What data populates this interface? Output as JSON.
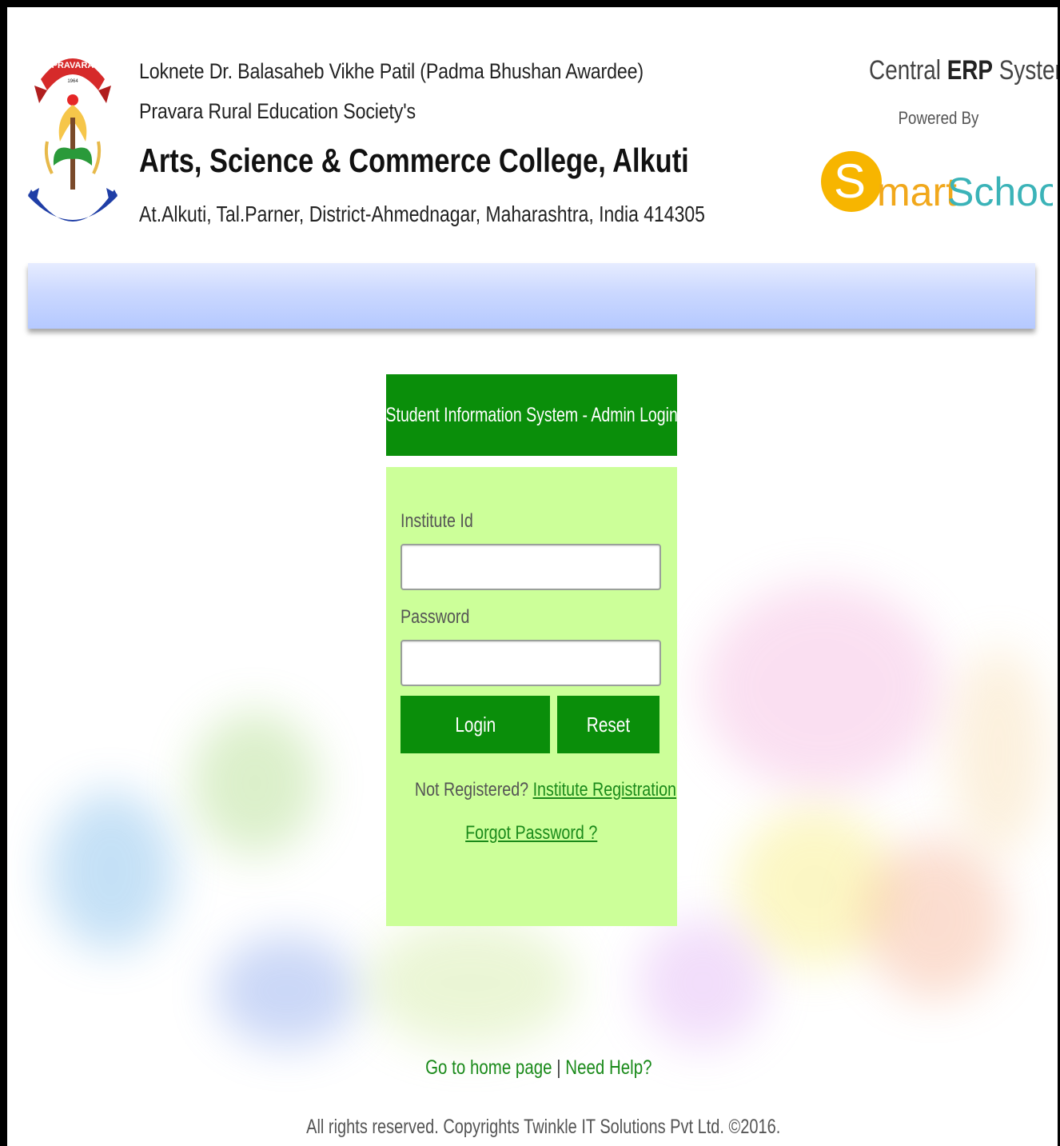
{
  "header": {
    "society_line": "Loknete Dr. Balasaheb Vikhe Patil (Padma Bhushan Awardee) Pravara Rural Education Society's",
    "college_name": "Arts, Science & Commerce College, Alkuti",
    "address": "At.Alkuti, Tal.Parner, District-Ahmednagar, Maharashtra, India 414305",
    "logo_text": "PRAVARA",
    "logo_year": "1964",
    "erp_prefix": "Central",
    "erp_bold": "ERP",
    "erp_suffix": "System",
    "powered_by": "Powered By",
    "brand_s": "S",
    "brand_mart": "mart",
    "brand_school": "School"
  },
  "login": {
    "title": "Student Information System - Admin Login",
    "institute_label": "Institute Id",
    "institute_value": "",
    "password_label": "Password",
    "password_value": "",
    "login_button": "Login",
    "reset_button": "Reset",
    "not_registered": "Not Registered?",
    "registration_link": "Institute Registration",
    "forgot_link": "Forgot Password ?"
  },
  "footer": {
    "home_link": "Go to home page",
    "separator": "|",
    "help_link": "Need Help?",
    "copyright": "All rights reserved. Copyrights Twinkle IT Solutions Pvt Ltd. ©2016."
  },
  "colors": {
    "primary_green": "#0a8e0a",
    "card_bg": "#ccff99",
    "link_green": "#1a8a1a",
    "bar_blue": "#cbd8ff",
    "brand_orange": "#f7b500",
    "brand_teal": "#3bb3b8"
  }
}
